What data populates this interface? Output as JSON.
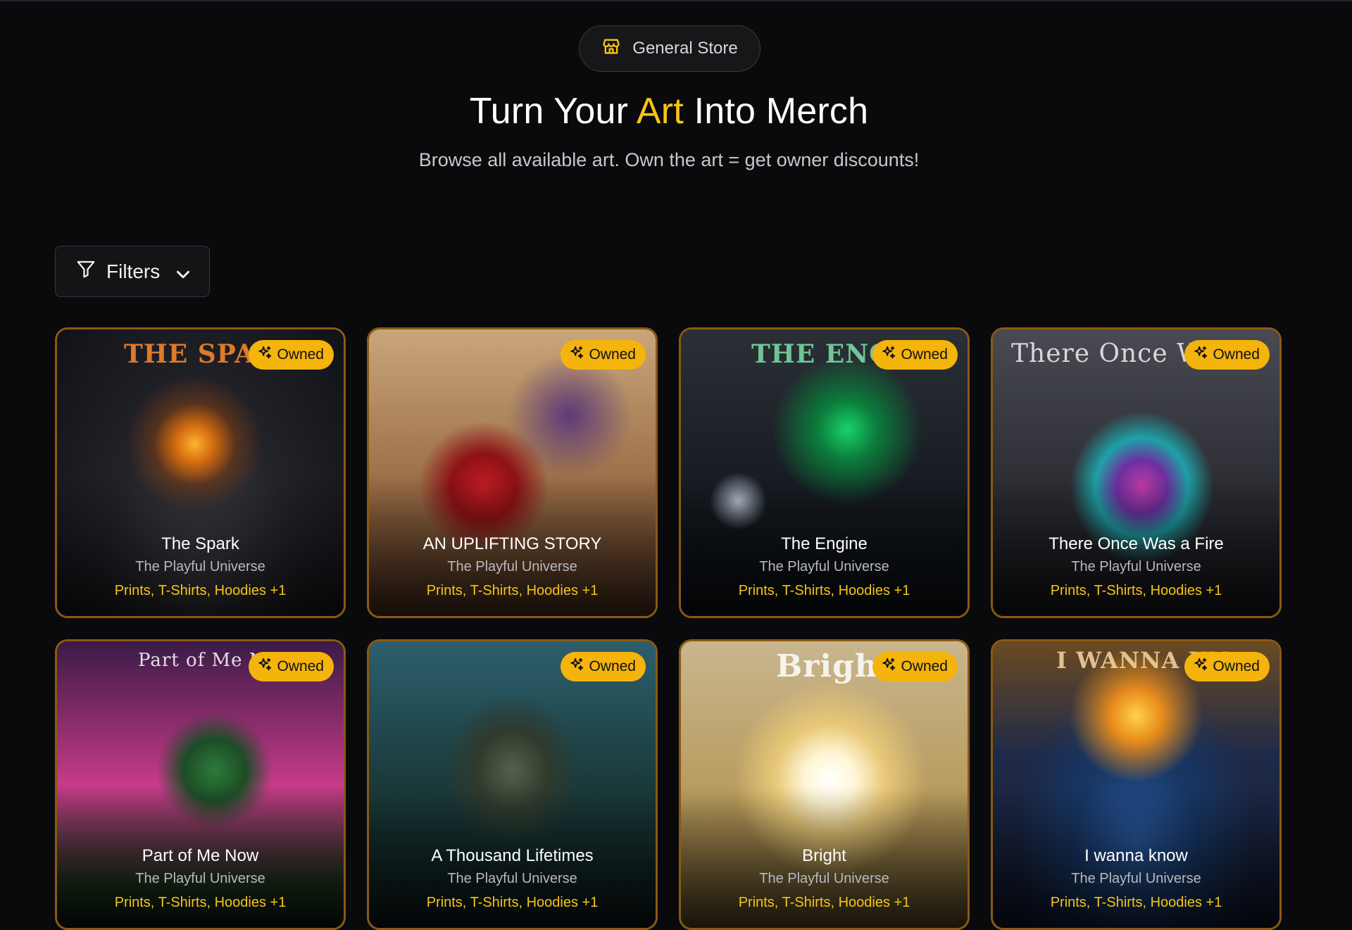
{
  "header": {
    "store_label": "General Store",
    "title_before": "Turn Your ",
    "title_accent": "Art",
    "title_after": " Into Merch",
    "subtitle": "Browse all available art. Own the art = get owner discounts!"
  },
  "toolbar": {
    "filters_label": "Filters"
  },
  "colors": {
    "accent": "#f5c518",
    "badge": "#f4b40c",
    "card_border": "#8a5a12",
    "background": "#0a0a0c"
  },
  "cards": [
    {
      "art_text": "THE SPAR",
      "badge": "Owned",
      "name": "The Spark",
      "artist": "The Playful Universe",
      "merch": "Prints, T-Shirts, Hoodies +1"
    },
    {
      "art_text": "",
      "badge": "Owned",
      "name": "AN UPLIFTING STORY",
      "artist": "The Playful Universe",
      "merch": "Prints, T-Shirts, Hoodies +1"
    },
    {
      "art_text": "THE ENGIN",
      "badge": "Owned",
      "name": "The Engine",
      "artist": "The Playful Universe",
      "merch": "Prints, T-Shirts, Hoodies +1"
    },
    {
      "art_text": "There Once Wa",
      "badge": "Owned",
      "name": "There Once Was a Fire",
      "artist": "The Playful Universe",
      "merch": "Prints, T-Shirts, Hoodies +1"
    },
    {
      "art_text": "Part of Me N",
      "badge": "Owned",
      "name": "Part of Me Now",
      "artist": "The Playful Universe",
      "merch": "Prints, T-Shirts, Hoodies +1"
    },
    {
      "art_text": "",
      "badge": "Owned",
      "name": "A Thousand Lifetimes",
      "artist": "The Playful Universe",
      "merch": "Prints, T-Shirts, Hoodies +1"
    },
    {
      "art_text": "Bright",
      "badge": "Owned",
      "name": "Bright",
      "artist": "The Playful Universe",
      "merch": "Prints, T-Shirts, Hoodies +1"
    },
    {
      "art_text": "I WANNA KN",
      "badge": "Owned",
      "name": "I wanna know",
      "artist": "The Playful Universe",
      "merch": "Prints, T-Shirts, Hoodies +1"
    }
  ]
}
